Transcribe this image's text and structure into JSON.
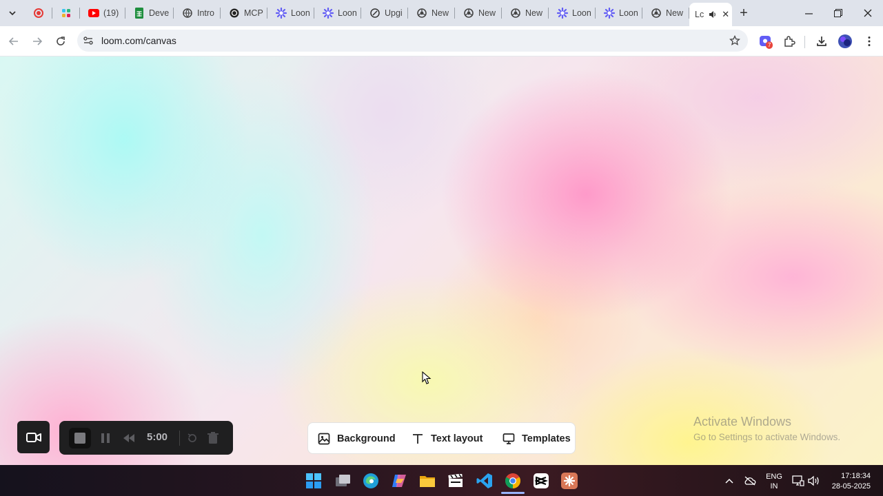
{
  "browser": {
    "tabs": [
      {
        "title": "",
        "icon": "record-icon",
        "color": "#e53935",
        "width": 40
      },
      {
        "title": "",
        "icon": "slack-icon",
        "color": "#e01e5a",
        "width": 40
      },
      {
        "title": "(19)",
        "icon": "youtube-icon",
        "color": "#ff0000",
        "width": 66
      },
      {
        "title": "Deve",
        "icon": "sheets-icon",
        "color": "#1e8e3e",
        "width": 70
      },
      {
        "title": "Intro",
        "icon": "globe-icon",
        "color": "#444444",
        "width": 68
      },
      {
        "title": "MCP",
        "icon": "openai-icon",
        "color": "#222222",
        "width": 68
      },
      {
        "title": "Loon",
        "icon": "loom-icon",
        "color": "#625df5",
        "width": 68
      },
      {
        "title": "Loon",
        "icon": "loom-icon",
        "color": "#625df5",
        "width": 68
      },
      {
        "title": "Upgi",
        "icon": "leaf-icon",
        "color": "#333333",
        "width": 68
      },
      {
        "title": "New",
        "icon": "chrome-icon",
        "color": "#444444",
        "width": 68
      },
      {
        "title": "New",
        "icon": "chrome-icon",
        "color": "#444444",
        "width": 68
      },
      {
        "title": "New",
        "icon": "chrome-icon",
        "color": "#444444",
        "width": 68
      },
      {
        "title": "Loon",
        "icon": "loom-icon",
        "color": "#625df5",
        "width": 68
      },
      {
        "title": "Loon",
        "icon": "loom-icon",
        "color": "#625df5",
        "width": 68
      },
      {
        "title": "New",
        "icon": "chrome-icon",
        "color": "#444444",
        "width": 68
      }
    ],
    "active_tab": {
      "title": "Lc",
      "icon": "speaker-icon"
    },
    "url": "loom.com/canvas",
    "extension_badge": "7"
  },
  "recorder": {
    "timer": "5:00"
  },
  "canvas_menu": {
    "background_label": "Background",
    "text_layout_label": "Text layout",
    "templates_label": "Templates"
  },
  "watermark": {
    "line1": "Activate Windows",
    "line2": "Go to Settings to activate Windows."
  },
  "taskbar": {
    "lang_top": "ENG",
    "lang_bottom": "IN",
    "time": "17:18:34",
    "date": "28-05-2025"
  },
  "colors": {
    "tabstrip": "#dfe3eb",
    "recorder_bg": "#1f1f20",
    "loom_purple": "#625df5"
  }
}
